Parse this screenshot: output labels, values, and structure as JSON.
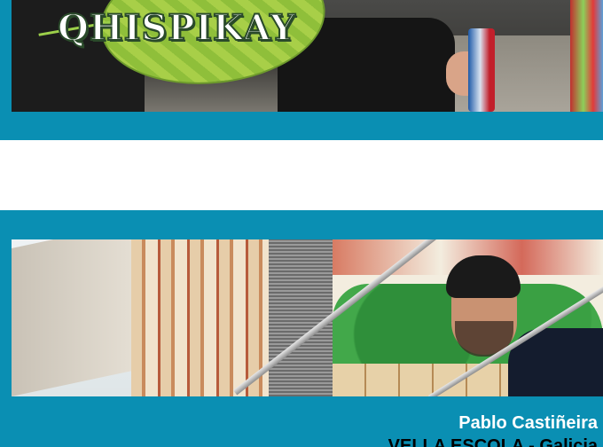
{
  "colors": {
    "band": "#0a8fb3",
    "page_background": "#ffffff",
    "caption_name": "#ffffff",
    "caption_place": "#000000"
  },
  "top_banner": {
    "logo_text": "QHISPIKAY"
  },
  "bottom_banner": {
    "caption_name": "Pablo Castiñeira",
    "caption_place": "VELLA ESCOLA - Galicia"
  }
}
